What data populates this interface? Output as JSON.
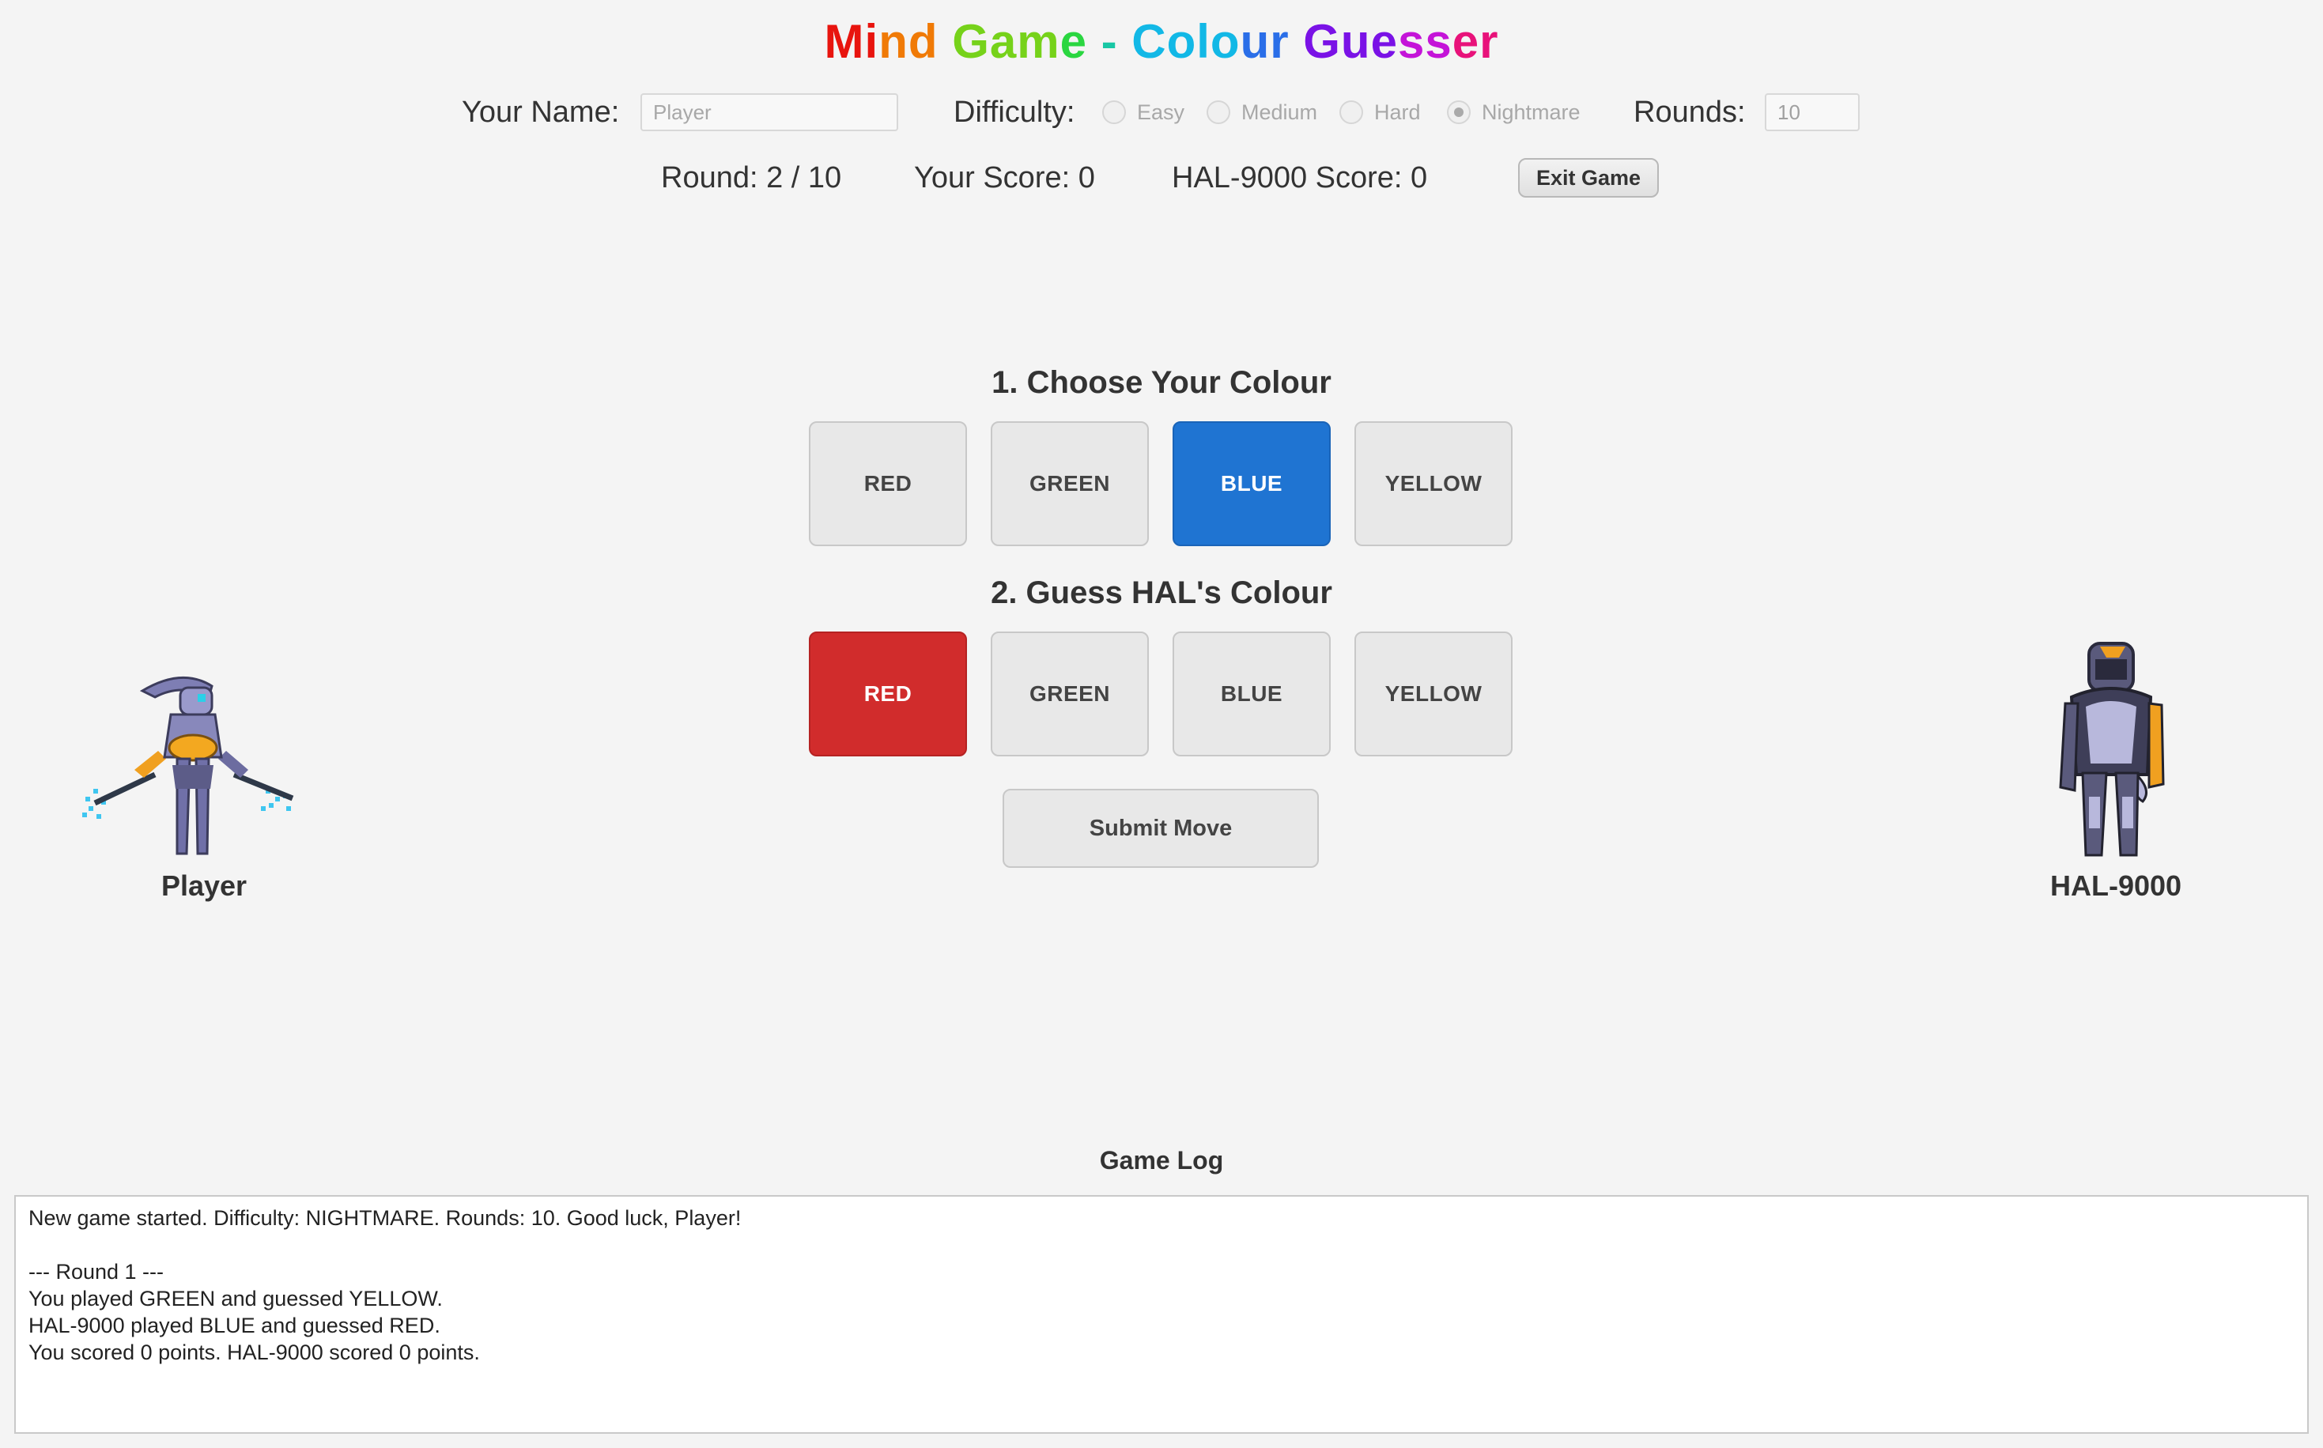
{
  "title": {
    "segments": [
      {
        "text": "Mi",
        "color": "#e8140e"
      },
      {
        "text": "nd",
        "color": "#f07a06"
      },
      {
        "text": " ",
        "color": "#000000"
      },
      {
        "text": "Gam",
        "color": "#76d21a"
      },
      {
        "text": "e",
        "color": "#2ad640"
      },
      {
        "text": " - ",
        "color": "#18c7a4"
      },
      {
        "text": "Colo",
        "color": "#12b8e6"
      },
      {
        "text": "ur",
        "color": "#2a6ee8"
      },
      {
        "text": " ",
        "color": "#000000"
      },
      {
        "text": "Gue",
        "color": "#7a12e6"
      },
      {
        "text": "ss",
        "color": "#c414d8"
      },
      {
        "text": "er",
        "color": "#e8127a"
      }
    ]
  },
  "settings": {
    "name_label": "Your Name:",
    "name_placeholder": "Player",
    "difficulty_label": "Difficulty:",
    "difficulty_options": [
      {
        "label": "Easy",
        "selected": false
      },
      {
        "label": "Medium",
        "selected": false
      },
      {
        "label": "Hard",
        "selected": false
      },
      {
        "label": "Nightmare",
        "selected": true
      }
    ],
    "rounds_label": "Rounds:",
    "rounds_value": "10"
  },
  "status": {
    "round": "Round: 2 / 10",
    "your_score": "Your Score: 0",
    "hal_score": "HAL-9000 Score: 0",
    "exit_label": "Exit Game"
  },
  "choose": {
    "heading": "1. Choose Your Colour",
    "buttons": [
      "RED",
      "GREEN",
      "BLUE",
      "YELLOW"
    ],
    "selected": "BLUE"
  },
  "guess": {
    "heading": "2. Guess HAL's Colour",
    "buttons": [
      "RED",
      "GREEN",
      "BLUE",
      "YELLOW"
    ],
    "selected": "RED"
  },
  "submit_label": "Submit Move",
  "player": {
    "name": "Player",
    "icon": "robot-player-icon"
  },
  "opponent": {
    "name": "HAL-9000",
    "icon": "robot-hal-icon"
  },
  "colors": {
    "selected_blue": "#1f74d2",
    "selected_red": "#d12c2c",
    "background": "#f4f4f4"
  },
  "log": {
    "title": "Game Log",
    "lines": [
      "New game started. Difficulty: NIGHTMARE. Rounds: 10. Good luck, Player!",
      "",
      "--- Round 1 ---",
      "You played GREEN and guessed YELLOW.",
      "HAL-9000 played BLUE and guessed RED.",
      "You scored 0 points. HAL-9000 scored 0 points."
    ]
  }
}
